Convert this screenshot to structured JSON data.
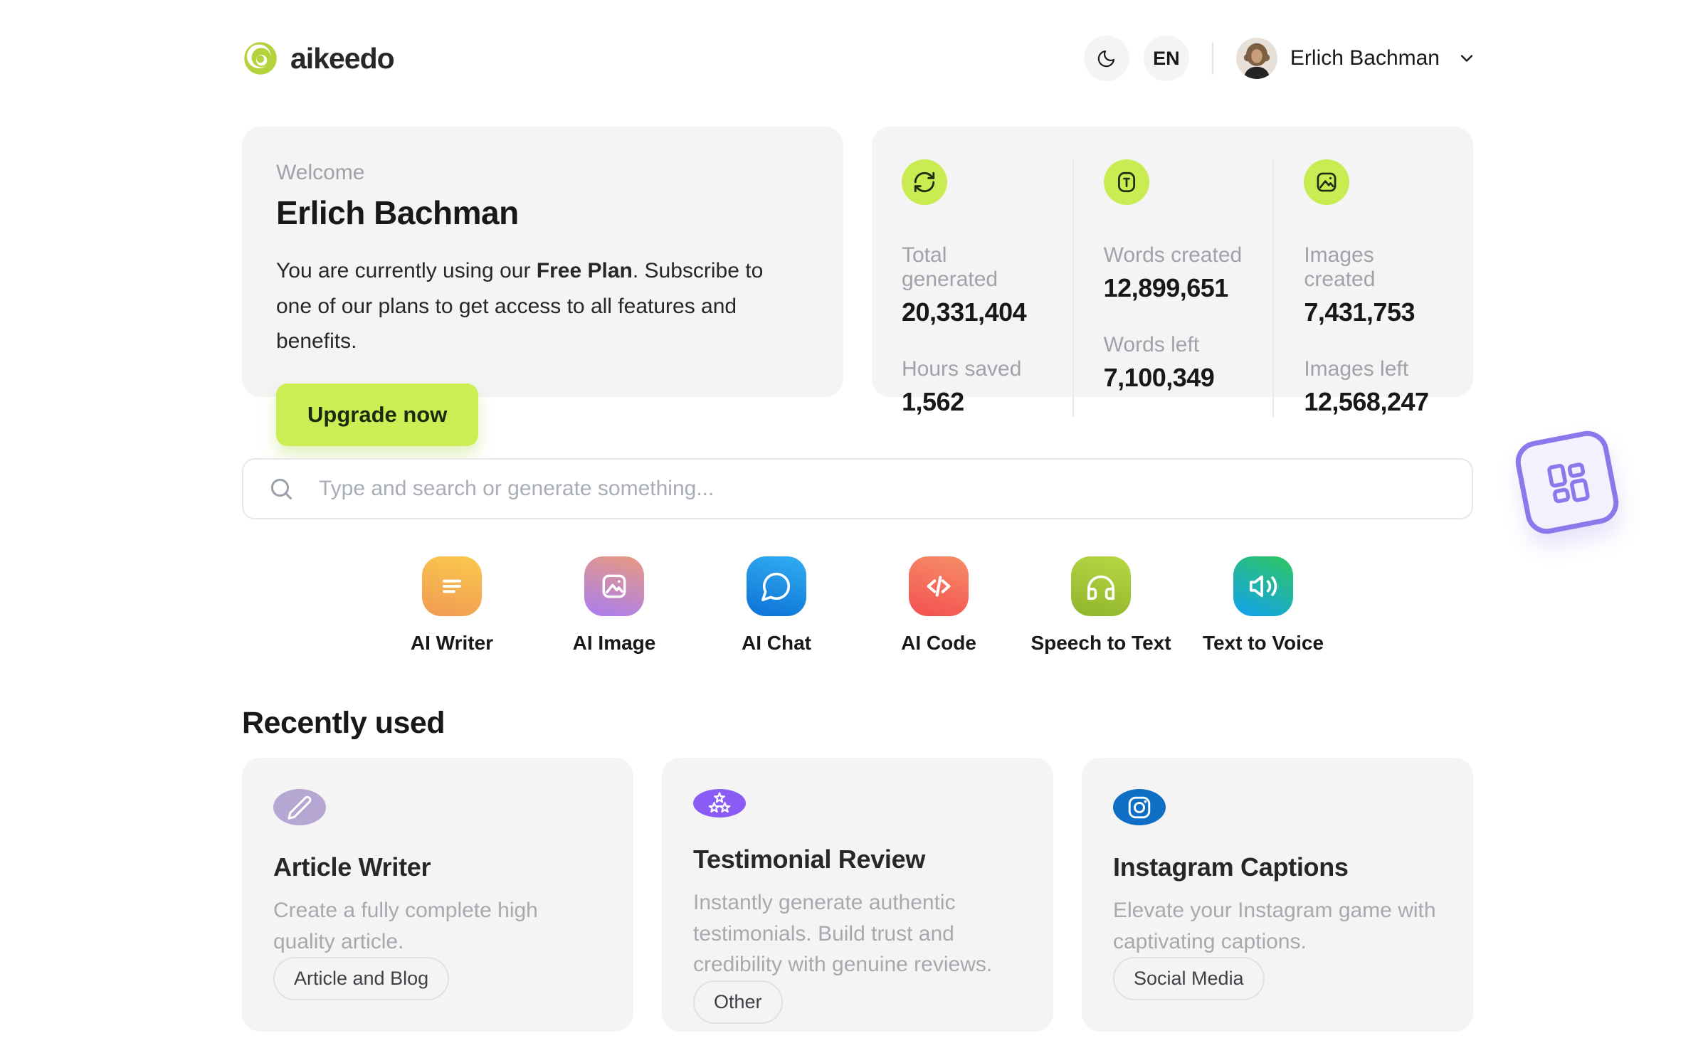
{
  "header": {
    "brand": "aikeedo",
    "language": "EN",
    "user_name": "Erlich Bachman"
  },
  "welcome": {
    "label": "Welcome",
    "name": "Erlich Bachman",
    "message_prefix": "You are currently using our ",
    "plan": "Free Plan",
    "message_suffix": ". Subscribe to one of our plans to get access to all features and benefits.",
    "cta": "Upgrade now"
  },
  "stats": {
    "columns": [
      {
        "icon": "refresh-icon",
        "top_label": "Total generated",
        "top_value": "20,331,404",
        "bottom_label": "Hours saved",
        "bottom_value": "1,562"
      },
      {
        "icon": "words-icon",
        "top_label": "Words created",
        "top_value": "12,899,651",
        "bottom_label": "Words left",
        "bottom_value": "7,100,349"
      },
      {
        "icon": "images-icon",
        "top_label": "Images created",
        "top_value": "7,431,753",
        "bottom_label": "Images left",
        "bottom_value": "12,568,247"
      }
    ]
  },
  "search": {
    "placeholder": "Type and search or generate something..."
  },
  "tools": [
    {
      "label": "AI Writer",
      "icon": "writer-icon",
      "gradient": [
        "#fbc94e",
        "#f09a52"
      ]
    },
    {
      "label": "AI Image",
      "icon": "image-icon",
      "gradient": [
        "#e89a80",
        "#a97df2"
      ]
    },
    {
      "label": "AI Chat",
      "icon": "chat-icon",
      "gradient": [
        "#33aef2",
        "#0b72d6"
      ]
    },
    {
      "label": "AI Code",
      "icon": "code-icon",
      "gradient": [
        "#f78e68",
        "#f25050"
      ]
    },
    {
      "label": "Speech to Text",
      "icon": "headphones-icon",
      "gradient": [
        "#b8d844",
        "#8fb42c"
      ]
    },
    {
      "label": "Text to Voice",
      "icon": "speaker-icon",
      "gradient": [
        "#2ec468",
        "#14a3e8"
      ]
    }
  ],
  "recent": {
    "heading": "Recently used",
    "cards": [
      {
        "title": "Article Writer",
        "description": "Create a fully complete high quality article.",
        "tag": "Article and Blog",
        "icon": "pencil-icon",
        "icon_bg": "#b5a6d2"
      },
      {
        "title": "Testimonial Review",
        "description": "Instantly generate authentic testimonials. Build trust and credibility with genuine reviews.",
        "tag": "Other",
        "icon": "stars-icon",
        "icon_bg": "#8a5cf6"
      },
      {
        "title": "Instagram Captions",
        "description": "Elevate your Instagram game with captivating captions.",
        "tag": "Social Media",
        "icon": "instagram-icon",
        "icon_bg": "#0e6fc5"
      }
    ]
  },
  "colors": {
    "accent_lime": "#cbee55",
    "stat_icon_bg": "#c9ec52",
    "card_bg": "#f4f4f5",
    "badge_purple": "#8b79ec",
    "logo_green": "#b4d23c"
  }
}
